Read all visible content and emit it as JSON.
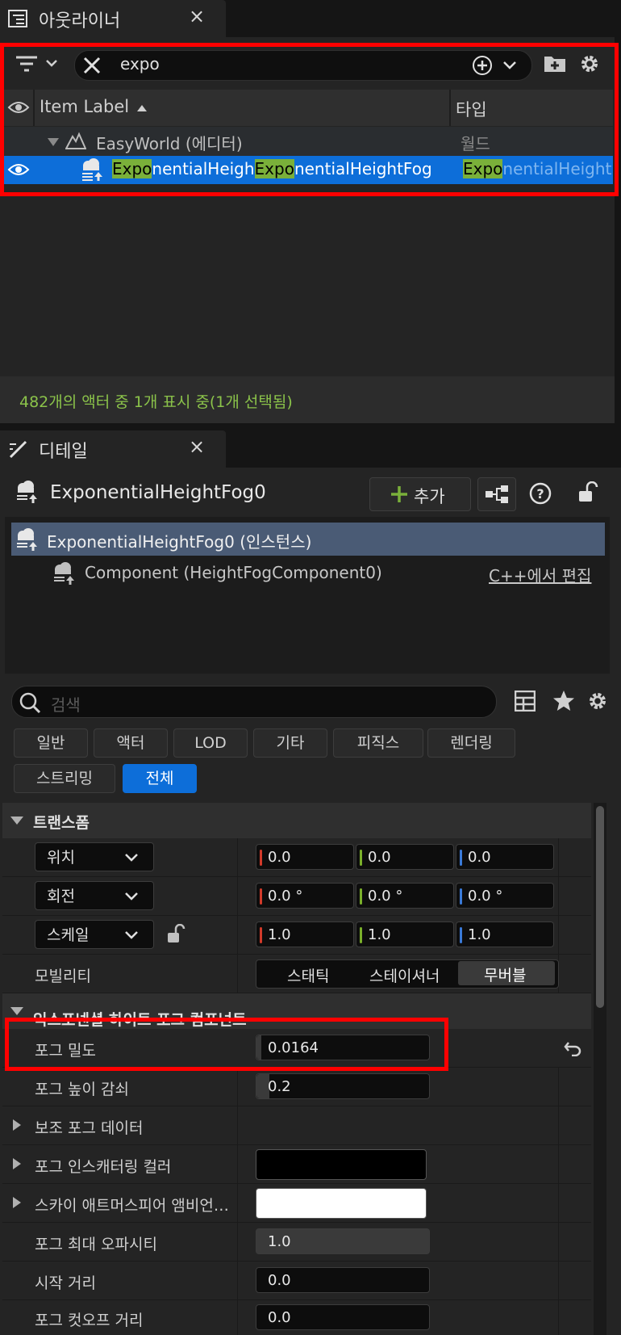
{
  "outliner": {
    "tab_title": "아웃라이너",
    "close_glyph": "×",
    "search_value": "expo",
    "col_label": "Item Label",
    "col_type": "타입",
    "rows": [
      {
        "label": "EasyWorld (에디터)",
        "type": "월드"
      },
      {
        "label_parts": [
          "Expo",
          "nentialHeigh",
          "Expo",
          "nentialHeightFog"
        ],
        "type_parts": [
          "Expo",
          "nentialHeight"
        ]
      }
    ],
    "status": "482개의 액터 중 1개 표시 중(1개 선택됨)"
  },
  "details": {
    "tab_title": "디테일",
    "close_glyph": "×",
    "actor_name": "ExponentialHeightFog0",
    "add_label": "추가",
    "tree": [
      {
        "label": "ExponentialHeightFog0 (인스턴스)"
      },
      {
        "label": "Component (HeightFogComponent0)",
        "action": "C++에서 편집"
      }
    ],
    "search_placeholder": "검색",
    "categories_row1": [
      "일반",
      "액터",
      "LOD",
      "기타",
      "피직스",
      "렌더링"
    ],
    "categories_row2": [
      "스트리밍",
      "전체"
    ],
    "active_category": "전체",
    "transform_section": "트랜스폼",
    "location": {
      "label": "위치",
      "x": "0.0",
      "y": "0.0",
      "z": "0.0"
    },
    "rotation": {
      "label": "회전",
      "x": "0.0 °",
      "y": "0.0 °",
      "z": "0.0 °"
    },
    "scale": {
      "label": "스케일",
      "x": "1.0",
      "y": "1.0",
      "z": "1.0"
    },
    "mobility": {
      "label": "모빌리티",
      "options": [
        "스태틱",
        "스테이셔너",
        "무버블"
      ],
      "selected": "무버블"
    },
    "fog_section": "익스포넨셜 하이트 포그 컴포넌트",
    "props": [
      {
        "label": "포그 밀도",
        "value": "0.0164"
      },
      {
        "label": "포그 높이 감쇠",
        "value": "0.2"
      },
      {
        "label": "보조 포그 데이터"
      },
      {
        "label": "포그 인스캐터링 컬러",
        "color": "#000000"
      },
      {
        "label": "스카이 애트머스피어 앰비언…",
        "color": "#ffffff"
      },
      {
        "label": "포그 최대 오파시티",
        "value": "1.0"
      },
      {
        "label": "시작 거리",
        "value": "0.0"
      },
      {
        "label": "포그 컷오프 거리",
        "value": "0.0"
      }
    ]
  },
  "colors": {
    "accent": "#0d6ed9",
    "highlight": "#7ab03a",
    "status_text": "#8bc34a",
    "x_axis": "#d23a2a",
    "y_axis": "#7ab02a",
    "z_axis": "#3a7ad8"
  }
}
